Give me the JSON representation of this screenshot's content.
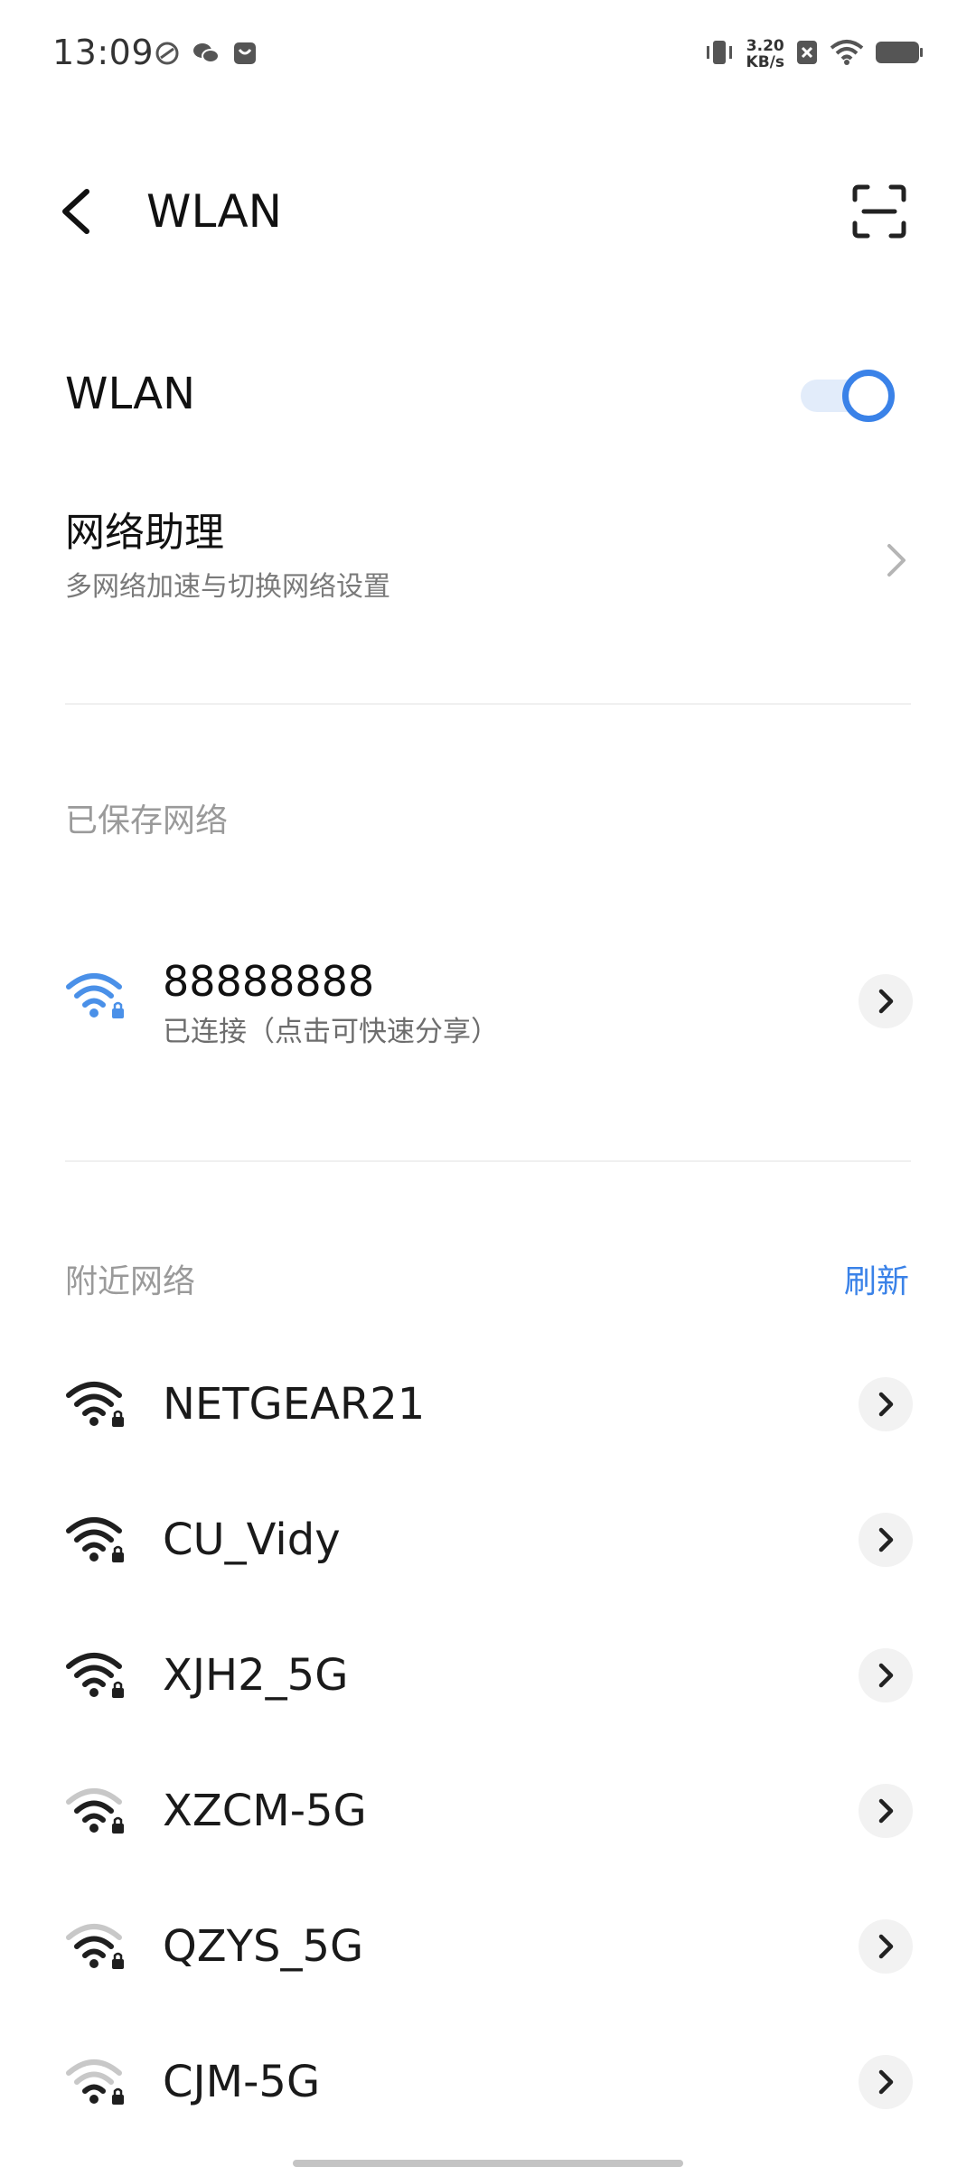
{
  "status_bar": {
    "time": "13:09",
    "net_speed_value": "3.20",
    "net_speed_unit": "KB/s"
  },
  "header": {
    "title": "WLAN"
  },
  "wlan_toggle": {
    "label": "WLAN",
    "enabled": true
  },
  "assistant": {
    "title": "网络助理",
    "subtitle": "多网络加速与切换网络设置"
  },
  "saved_section": {
    "header": "已保存网络",
    "network": {
      "name": "88888888",
      "status": "已连接（点击可快速分享）"
    }
  },
  "nearby_section": {
    "header": "附近网络",
    "refresh_label": "刷新",
    "networks": [
      {
        "name": "NETGEAR21",
        "signal": 4,
        "secured": true
      },
      {
        "name": "CU_Vidy",
        "signal": 4,
        "secured": true
      },
      {
        "name": "XJH2_5G",
        "signal": 4,
        "secured": true
      },
      {
        "name": "XZCM-5G",
        "signal": 3,
        "secured": true
      },
      {
        "name": "QZYS_5G",
        "signal": 3,
        "secured": true
      },
      {
        "name": "CJM-5G",
        "signal": 2,
        "secured": true
      }
    ]
  },
  "colors": {
    "accent": "#3a82e8",
    "wifi_dark": "#1f1f1f",
    "wifi_faint": "#c8c8c8"
  }
}
